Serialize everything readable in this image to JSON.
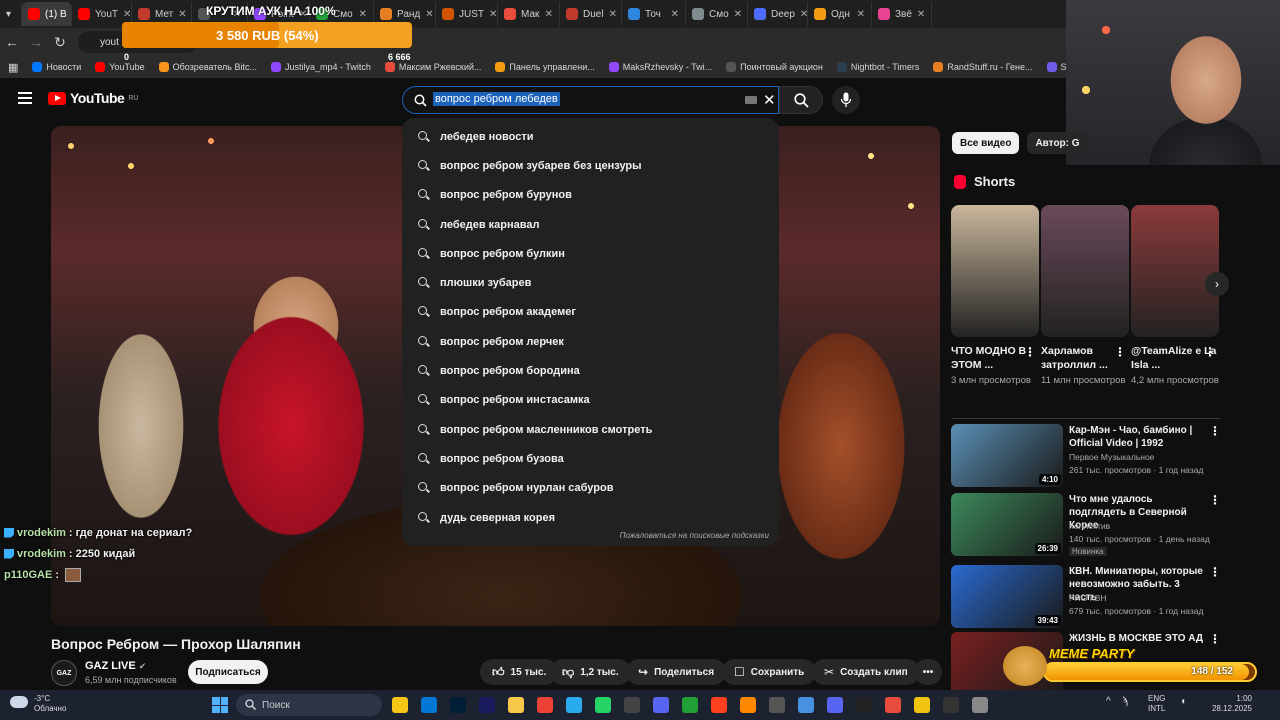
{
  "browser": {
    "tabs": [
      {
        "label": "(1) В",
        "color": "#ff0000",
        "active": true
      },
      {
        "label": "YouT",
        "color": "#ff0000"
      },
      {
        "label": "Мет",
        "color": "#c0392b"
      },
      {
        "label": "",
        "color": "#555"
      },
      {
        "label": "Point",
        "color": "#9146ff"
      },
      {
        "label": "Смо",
        "color": "#21a038"
      },
      {
        "label": "Ранд",
        "color": "#e67e22"
      },
      {
        "label": "JUST",
        "color": "#d35400"
      },
      {
        "label": "Мак",
        "color": "#e74c3c"
      },
      {
        "label": "Duel",
        "color": "#c0392b"
      },
      {
        "label": "Точ",
        "color": "#2e86de"
      },
      {
        "label": "Смо",
        "color": "#7f8c8d"
      },
      {
        "label": "Deep",
        "color": "#4d6bfe"
      },
      {
        "label": "Одн",
        "color": "#f39c12"
      },
      {
        "label": "Звё",
        "color": "#e84393"
      }
    ],
    "url": "yout",
    "bookmarks": [
      {
        "label": "Новости",
        "color": "#0077ff"
      },
      {
        "label": "YouTube",
        "color": "#ff0000"
      },
      {
        "label": "Обозреватель Bitc...",
        "color": "#f7931a"
      },
      {
        "label": "Justilya_mp4 - Twitch",
        "color": "#9146ff"
      },
      {
        "label": "Максим Ржевский...",
        "color": "#e74c3c"
      },
      {
        "label": "Панель управлени...",
        "color": "#f39c12"
      },
      {
        "label": "MaksRzhevsky - Twi...",
        "color": "#9146ff"
      },
      {
        "label": "Поинтовый аукцион",
        "color": "#555555"
      },
      {
        "label": "Nightbot - Timers",
        "color": "#2c3e50"
      },
      {
        "label": "RandStuff.ru - Гене...",
        "color": "#e67e22"
      },
      {
        "label": "StreamElements - M...",
        "color": "#6c5ce7"
      }
    ]
  },
  "youtube": {
    "logo_word": "YouTube",
    "logo_region": "RU",
    "search_query": "вопрос ребром лебедев",
    "suggestions": [
      "лебедев новости",
      "вопрос ребром зубарев без цензуры",
      "вопрос ребром бурунов",
      "лебедев карнавал",
      "вопрос ребром булкин",
      "плюшки зубарев",
      "вопрос ребром академег",
      "вопрос ребром лерчек",
      "вопрос ребром бородина",
      "вопрос ребром инстасамка",
      "вопрос ребром масленников смотреть",
      "вопрос ребром бузова",
      "вопрос ребром нурлан сабуров",
      "дудь северная корея"
    ],
    "report_suggestions": "Пожаловаться на поисковые подсказки",
    "video_title": "Вопрос Ребром — Прохор Шаляпин",
    "channel": {
      "avatar_text": "GAZ",
      "name": "GAZ LIVE",
      "subs": "6,59 млн подписчиков",
      "subscribe_label": "Подписаться"
    },
    "actions": {
      "likes": "15 тыс.",
      "dislikes": "1,2 тыс.",
      "share": "Поделиться",
      "save": "Сохранить",
      "clip": "Создать клип",
      "more": "•••"
    },
    "chips": {
      "all": "Все видео",
      "author": "Автор: G"
    },
    "shorts_title": "Shorts",
    "shorts": [
      {
        "title": "ЧТО МОДНО В ЭТОМ ...",
        "views": "3 млн просмотров",
        "bg": "#c9b79c"
      },
      {
        "title": "Харламов затроллил ...",
        "views": "11 млн просмотров",
        "bg": "#6a4a5a"
      },
      {
        "title": "@TeamAlize e La Isla ...",
        "views": "4,2 млн просмотров",
        "bg": "#8c3a3a"
      }
    ],
    "recommended": [
      {
        "title": "Кар-Мэн - Чао, бамбино | Official Video | 1992",
        "channel": "Первое Музыкальное",
        "meta": "261 тыс. просмотров · 1 год назад",
        "duration": "4:10",
        "bg": "#5a8fb5",
        "badge": ""
      },
      {
        "title": "Что мне удалось подглядеть в Северной Корее",
        "channel": "Коллектив",
        "meta": "140 тыс. просмотров · 1 день назад",
        "duration": "26:39",
        "bg": "#3c8a5c",
        "badge": "Новинка"
      },
      {
        "title": "КВН. Миниатюры, которые невозможно забыть. 3 часть",
        "channel": "PRO КВН",
        "meta": "679 тыс. просмотров · 1 год назад",
        "duration": "39:43",
        "bg": "#2a6ad1",
        "badge": ""
      },
      {
        "title": "ЖИЗНЬ В МОСКВЕ ЭТО АД",
        "channel": "",
        "meta": "",
        "duration": "",
        "bg": "#7a2020",
        "badge": ""
      }
    ]
  },
  "overlays": {
    "donation_title": "КРУТИМ АУК НА 100%",
    "donation_amount": "3 580 RUB (54%)",
    "donation_progress": 0.54,
    "donation_min": "0",
    "donation_max": "6 666",
    "chat": [
      {
        "nick": "vrodekim",
        "text": ": где донат на сериал?"
      },
      {
        "nick": "vrodekim",
        "text": ": 2250 кидай"
      },
      {
        "nick": "p110GAE",
        "text": " :"
      }
    ],
    "meme_label": "MEME PARTY",
    "meme_count": "148 / 152",
    "meme_progress": 0.97
  },
  "taskbar": {
    "temp": "-3°C",
    "weather": "Облачно",
    "search": "Поиск",
    "lang1": "ENG",
    "lang2": "INTL",
    "time": "1:00",
    "date": "28.12.2025"
  }
}
